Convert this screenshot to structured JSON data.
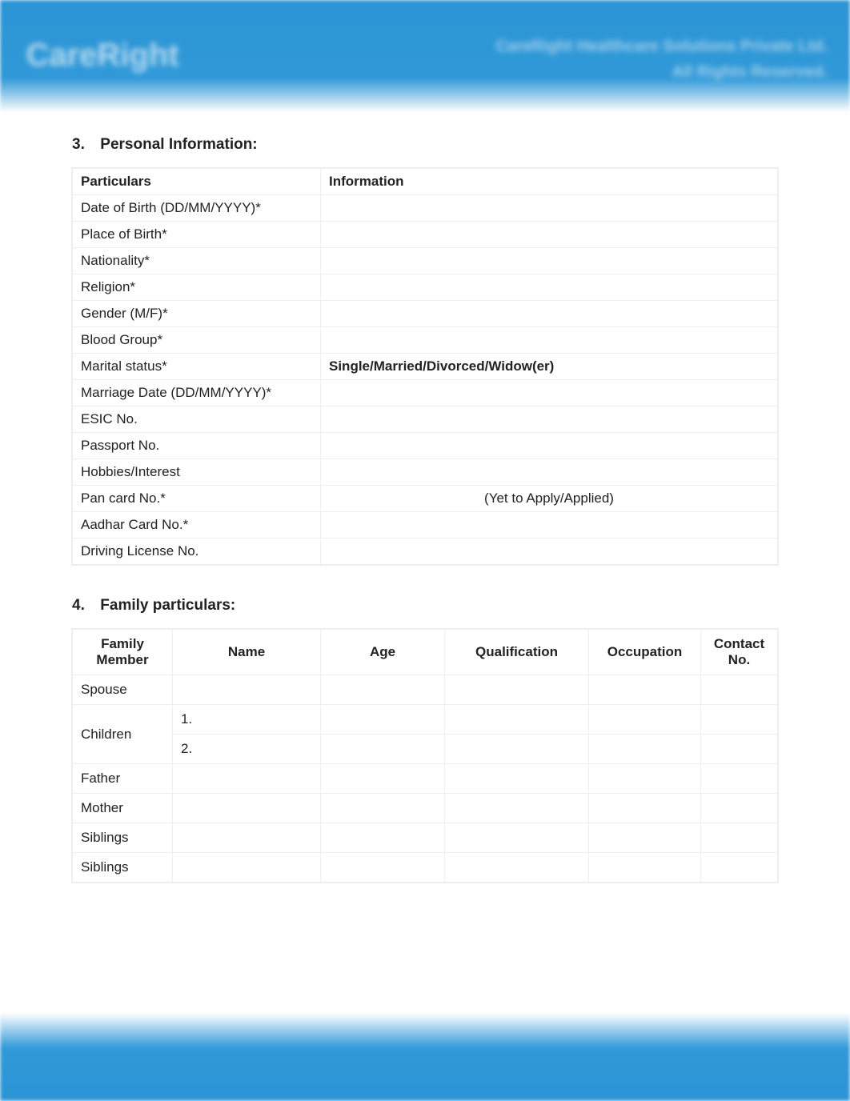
{
  "header": {
    "logo_text": "CareRight",
    "company_line1": "CareRight Healthcare Solutions Private Ltd.",
    "company_line2": "All Rights Reserved."
  },
  "section3": {
    "number": "3.",
    "title": "Personal  Information:",
    "columns": {
      "particulars": "Particulars",
      "information": "Information"
    },
    "rows": [
      {
        "label": "Date of Birth (DD/MM/YYYY)*",
        "value": ""
      },
      {
        "label": "Place of Birth*",
        "value": ""
      },
      {
        "label": "Nationality*",
        "value": ""
      },
      {
        "label": "Religion*",
        "value": ""
      },
      {
        "label": "Gender (M/F)*",
        "value": ""
      },
      {
        "label": "Blood Group*",
        "value": ""
      },
      {
        "label": "Marital status*",
        "value": "Single/Married/Divorced/Widow(er)",
        "bold": true
      },
      {
        "label": "Marriage Date (DD/MM/YYYY)*",
        "value": ""
      },
      {
        "label": "ESIC No.",
        "value": ""
      },
      {
        "label": "Passport No.",
        "value": ""
      },
      {
        "label": "Hobbies/Interest",
        "value": ""
      },
      {
        "label": "Pan card No.*",
        "value": "(Yet to Apply/Applied)",
        "center": true
      },
      {
        "label": "Aadhar Card No.*",
        "value": ""
      },
      {
        "label": "Driving License No.",
        "value": ""
      }
    ]
  },
  "section4": {
    "number": "4.",
    "title": "Family particulars:",
    "columns": [
      "Family Member",
      "Name",
      "Age",
      "Qualification",
      "Occupation",
      "Contact No."
    ],
    "rows": [
      {
        "member": "Spouse",
        "names": [
          ""
        ],
        "age": "",
        "qualification": "",
        "occupation": "",
        "contact": ""
      },
      {
        "member": "Children",
        "names": [
          "1.",
          "2."
        ],
        "age": "",
        "qualification": "",
        "occupation": "",
        "contact": ""
      },
      {
        "member": "Father",
        "names": [
          ""
        ],
        "age": "",
        "qualification": "",
        "occupation": "",
        "contact": ""
      },
      {
        "member": "Mother",
        "names": [
          ""
        ],
        "age": "",
        "qualification": "",
        "occupation": "",
        "contact": ""
      },
      {
        "member": "Siblings",
        "names": [
          ""
        ],
        "age": "",
        "qualification": "",
        "occupation": "",
        "contact": ""
      },
      {
        "member": "Siblings",
        "names": [
          ""
        ],
        "age": "",
        "qualification": "",
        "occupation": "",
        "contact": ""
      }
    ]
  }
}
